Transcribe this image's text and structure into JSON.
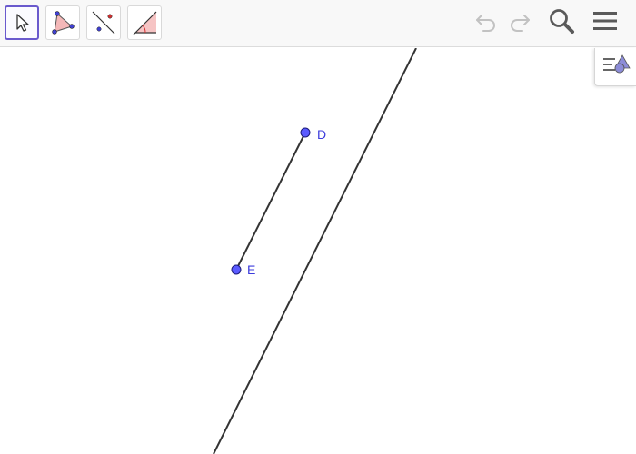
{
  "toolbar": {
    "tools": [
      {
        "id": "move",
        "icon": "move-pointer-icon",
        "selected": true
      },
      {
        "id": "polygon",
        "icon": "polygon-icon",
        "selected": false
      },
      {
        "id": "point-line",
        "icon": "line-through-points-icon",
        "selected": false
      },
      {
        "id": "angle",
        "icon": "angle-icon",
        "selected": false
      }
    ],
    "actions": [
      {
        "id": "undo",
        "icon": "undo-icon",
        "enabled": false
      },
      {
        "id": "redo",
        "icon": "redo-icon",
        "enabled": false
      },
      {
        "id": "search",
        "icon": "search-icon",
        "enabled": true
      },
      {
        "id": "menu",
        "icon": "hamburger-menu-icon",
        "enabled": true
      }
    ]
  },
  "style_bar_toggle": {
    "icon": "style-bar-icon"
  },
  "graphics": {
    "points": [
      {
        "name": "D",
        "label": "D",
        "color": "#3c3cdc"
      },
      {
        "name": "E",
        "label": "E",
        "color": "#3c3cdc"
      }
    ],
    "segments": [
      {
        "name": "segment-DE",
        "from": "D",
        "to": "E",
        "color": "#333333"
      }
    ],
    "lines": [
      {
        "name": "line-f",
        "color": "#333333"
      }
    ]
  },
  "colors": {
    "point_fill": "#5b5bff",
    "point_stroke": "#1a1a7a",
    "label": "#3c3cdc",
    "selected_tool_border": "#6a5acd",
    "line": "#333333"
  }
}
